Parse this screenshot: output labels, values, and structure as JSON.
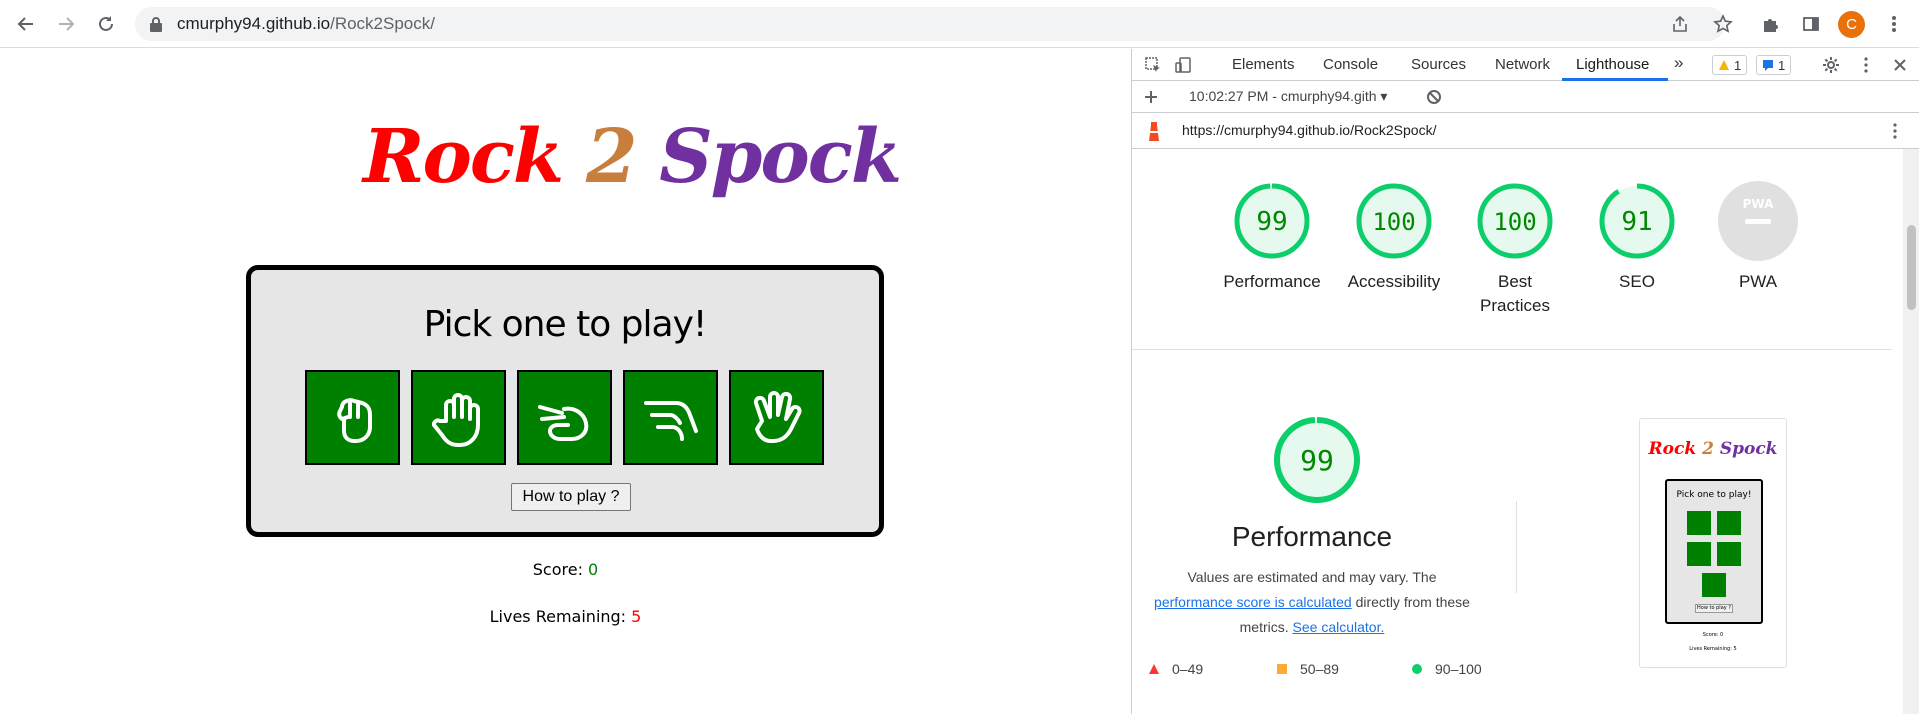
{
  "browser": {
    "url_host": "cmurphy94.github.io",
    "url_path": "/Rock2Spock/",
    "avatar_letter": "C"
  },
  "page": {
    "logo": {
      "word1": "Rock",
      "word2": "2",
      "word3": "Spock"
    },
    "pick_title": "Pick one to play!",
    "choices": [
      {
        "name": "rock",
        "icon": "fist-icon"
      },
      {
        "name": "paper",
        "icon": "open-hand-icon"
      },
      {
        "name": "scissors",
        "icon": "scissors-hand-icon"
      },
      {
        "name": "lizard",
        "icon": "lizard-hand-icon"
      },
      {
        "name": "spock",
        "icon": "spock-hand-icon"
      }
    ],
    "how_to_play": "How to play ?",
    "score_label": "Score:",
    "score_value": "0",
    "lives_label": "Lives Remaining:",
    "lives_value": "5"
  },
  "devtools": {
    "tabs": [
      "Elements",
      "Console",
      "Sources",
      "Network",
      "Lighthouse"
    ],
    "active_tab": "Lighthouse",
    "more_tabs": "»",
    "warnings_count": "1",
    "messages_count": "1",
    "report_time": "10:02:27 PM - cmurphy94.gith",
    "report_url": "https://cmurphy94.github.io/Rock2Spock/",
    "scores": [
      {
        "label": "Performance",
        "value": "99",
        "fraction": 0.99
      },
      {
        "label": "Accessibility",
        "value": "100",
        "fraction": 1.0
      },
      {
        "label": "Best Practices",
        "value": "100",
        "fraction": 1.0
      },
      {
        "label": "SEO",
        "value": "91",
        "fraction": 0.91
      },
      {
        "label": "PWA",
        "value": "PWA",
        "fraction": 0
      }
    ],
    "perf_score": "99",
    "perf_title": "Performance",
    "perf_desc_1": "Values are estimated and may vary. The",
    "perf_link_1": "performance score is calculated",
    "perf_desc_2": "directly from these metrics.",
    "perf_link_2": "See calculator.",
    "legend": [
      "0–49",
      "50–89",
      "90–100"
    ],
    "thumbnail": {
      "logo_w1": "Rock",
      "logo_w2": "2",
      "logo_w3": "Spock",
      "pick": "Pick one to play!",
      "howto": "How to play ?",
      "score": "Score: 0",
      "lives": "Lives Remaining: 5"
    }
  },
  "colors": {
    "good": "#0cce6b",
    "good_text": "#008800",
    "choice_green": "#008000",
    "accent": "#1a73e8"
  }
}
